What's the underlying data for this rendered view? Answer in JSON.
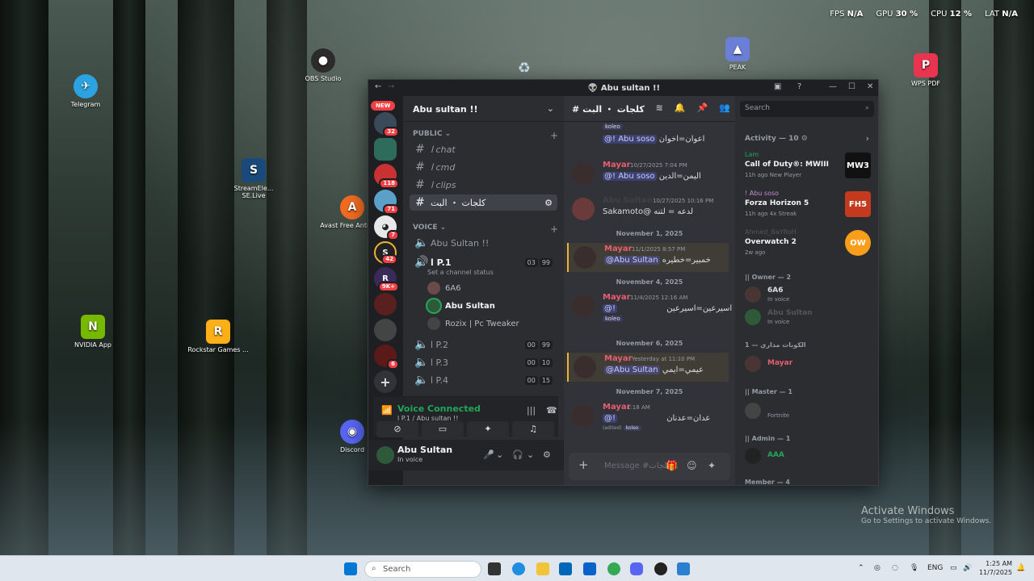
{
  "desktop": {
    "icons": [
      {
        "label": "Telegram",
        "color": "#2aa3e0",
        "glyph": "✈"
      },
      {
        "label": "OBS Studio",
        "color": "#2b2b2b",
        "glyph": "●"
      },
      {
        "label": "StreamEle... SE.Live",
        "color": "#1a4a7a",
        "glyph": "S"
      },
      {
        "label": "Avast Free Antivirus",
        "color": "#f26b21",
        "glyph": "A"
      },
      {
        "label": "NVIDIA App",
        "color": "#76b900",
        "glyph": "N"
      },
      {
        "label": "Rockstar Games ...",
        "color": "#fcaf17",
        "glyph": "R"
      },
      {
        "label": "PEAK",
        "color": "#6b7fd7",
        "glyph": "▲"
      },
      {
        "label": "WPS PDF",
        "color": "#e8344e",
        "glyph": "P"
      },
      {
        "label": "Discord",
        "color": "#5865f2",
        "glyph": "◉"
      }
    ],
    "perf": {
      "fps_label": "FPS",
      "fps_value": "N/A",
      "gpu_label": "GPU",
      "gpu_value": "30 %",
      "cpu_label": "CPU",
      "cpu_value": "12 %",
      "lat_label": "LAT",
      "lat_value": "N/A"
    },
    "activate": {
      "title": "Activate Windows",
      "sub": "Go to Settings to activate Windows."
    }
  },
  "window": {
    "title": "Abu sultan !!",
    "title_icon": "alien-icon"
  },
  "guilds": {
    "new_label": "NEW",
    "badges": [
      "32",
      "118",
      "71",
      "7",
      "42",
      "9K+",
      "6"
    ]
  },
  "channels": {
    "server_name": "Abu sultan !!",
    "public_label": "PUBLIC",
    "voice_label": "VOICE",
    "text": [
      {
        "name": "ا chat"
      },
      {
        "name": "ا cmd"
      },
      {
        "name": "ا clips"
      },
      {
        "name": "كلجات ・ البت"
      }
    ],
    "voice_lobby": "Abu Sultan !!",
    "voice": [
      {
        "name": "ا P.1",
        "c1": "03",
        "c2": "99"
      },
      {
        "name": "ا P.2",
        "c1": "00",
        "c2": "99"
      },
      {
        "name": "ا P.3",
        "c1": "00",
        "c2": "10"
      },
      {
        "name": "ا P.4",
        "c1": "00",
        "c2": "15"
      }
    ],
    "channel_status": "Set a channel status",
    "voice_users": [
      "6A6",
      "Abu Sultan",
      "Rozix | Pc Tweaker"
    ]
  },
  "voice_panel": {
    "status": "Voice Connected",
    "location": "ا P.1 / Abu sultan !!"
  },
  "user": {
    "name": "Abu Sultan",
    "status": "In voice"
  },
  "chat": {
    "channel_name": "كلجات ・ البت",
    "messages": [
      {
        "author": "",
        "time": "",
        "mention": "@! Abu soso",
        "text": "اعوان=اخوان",
        "tag": "koleo"
      },
      {
        "author": "Mayar",
        "time": "10/27/2025 7:04 PM",
        "mention": "@! Abu soso",
        "text": "اليمن=الدين",
        "tag": ""
      },
      {
        "author": "Abu Sultan",
        "time": "10/27/2025 10:16 PM",
        "mention": "",
        "text": "Sakamoto@ لدعه = لتنه",
        "tag": ""
      },
      {
        "author": "Mayar",
        "time": "11/1/2025 8:57 PM",
        "mention": "@Abu Sultan",
        "text": "خمبير=خطيره",
        "tag": ""
      },
      {
        "author": "Mayar",
        "time": "11/4/2025 12:16 AM",
        "mention": "@!",
        "text": "اسيرعين=اسيرعين",
        "tag": "koleo"
      },
      {
        "author": "Mayar",
        "time": "Yesterday at 11:10 PM",
        "mention": "@Abu Sultan",
        "text": "عيمي=ايمي",
        "tag": ""
      },
      {
        "author": "Mayar",
        "time": "1:18 AM",
        "mention": "@!",
        "text": "عدان=عدنان",
        "tag": "koleo",
        "edited": "(edited)"
      }
    ],
    "days": [
      "November 1, 2025",
      "November 4, 2025",
      "November 6, 2025",
      "November 7, 2025"
    ],
    "input_placeholder": "Message #كلجات..."
  },
  "sidebar": {
    "search_placeholder": "Search",
    "activity_header": "Activity — 10",
    "activities": [
      {
        "user": "Lam",
        "game": "Call of Duty®: MWIII",
        "meta": "11h ago  New Player",
        "art": "MW3",
        "color": "#111"
      },
      {
        "user": "! Abu soso",
        "game": "Forza Horizon 5",
        "meta": "11h ago  4x Streak",
        "art": "FH5",
        "color": "#c33a1e"
      },
      {
        "user": "Ahmed_BaYRoH",
        "game": "Overwatch 2",
        "meta": "2w ago",
        "art": "OW",
        "color": "#f99e1a"
      }
    ],
    "roles": [
      {
        "label": "|| Owner — 2",
        "members": [
          {
            "name": "6A6",
            "status": "In voice"
          },
          {
            "name": "Abu Sultan",
            "status": "In voice"
          }
        ]
      },
      {
        "label": "الكوبات مداري — 1",
        "members": [
          {
            "name": "Mayar",
            "status": ""
          }
        ]
      },
      {
        "label": "|| Master — 1",
        "members": [
          {
            "name": "",
            "status": "Fortnite"
          }
        ]
      },
      {
        "label": "|| Admin — 1",
        "members": [
          {
            "name": "AAA",
            "status": ""
          }
        ]
      }
    ],
    "member_header": "Member — 4"
  },
  "taskbar": {
    "search": "Search",
    "lang": "ENG",
    "time": "1:25 AM",
    "date": "11/7/2025"
  }
}
